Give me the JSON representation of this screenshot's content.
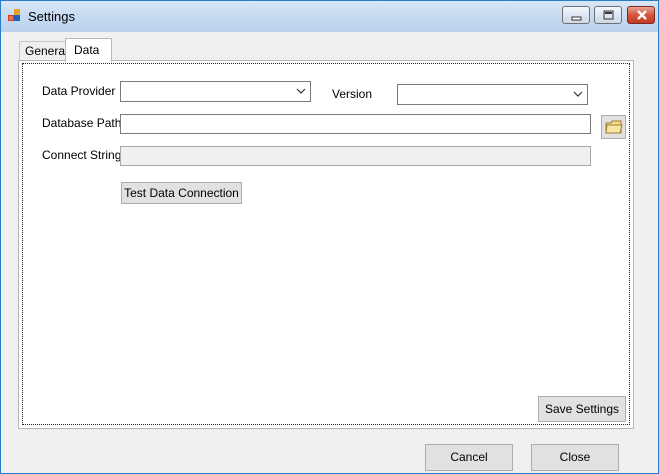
{
  "window": {
    "title": "Settings"
  },
  "tabs": [
    {
      "label": "General",
      "selected": false
    },
    {
      "label": "Data",
      "selected": true
    }
  ],
  "data_tab": {
    "data_provider": {
      "label": "Data Provider",
      "value": ""
    },
    "version": {
      "label": "Version",
      "value": ""
    },
    "database_path": {
      "label": "Database Path",
      "value": ""
    },
    "connect_string": {
      "label": "Connect String",
      "value": ""
    },
    "browse_icon": "folder-icon",
    "test_button": "Test Data Connection",
    "save_button": "Save Settings"
  },
  "footer": {
    "cancel_button": "Cancel",
    "close_button": "Close"
  },
  "colors": {
    "titlebar": "#c6daf1",
    "close_button": "#c23a22",
    "window_border": "#2b7cc6"
  }
}
